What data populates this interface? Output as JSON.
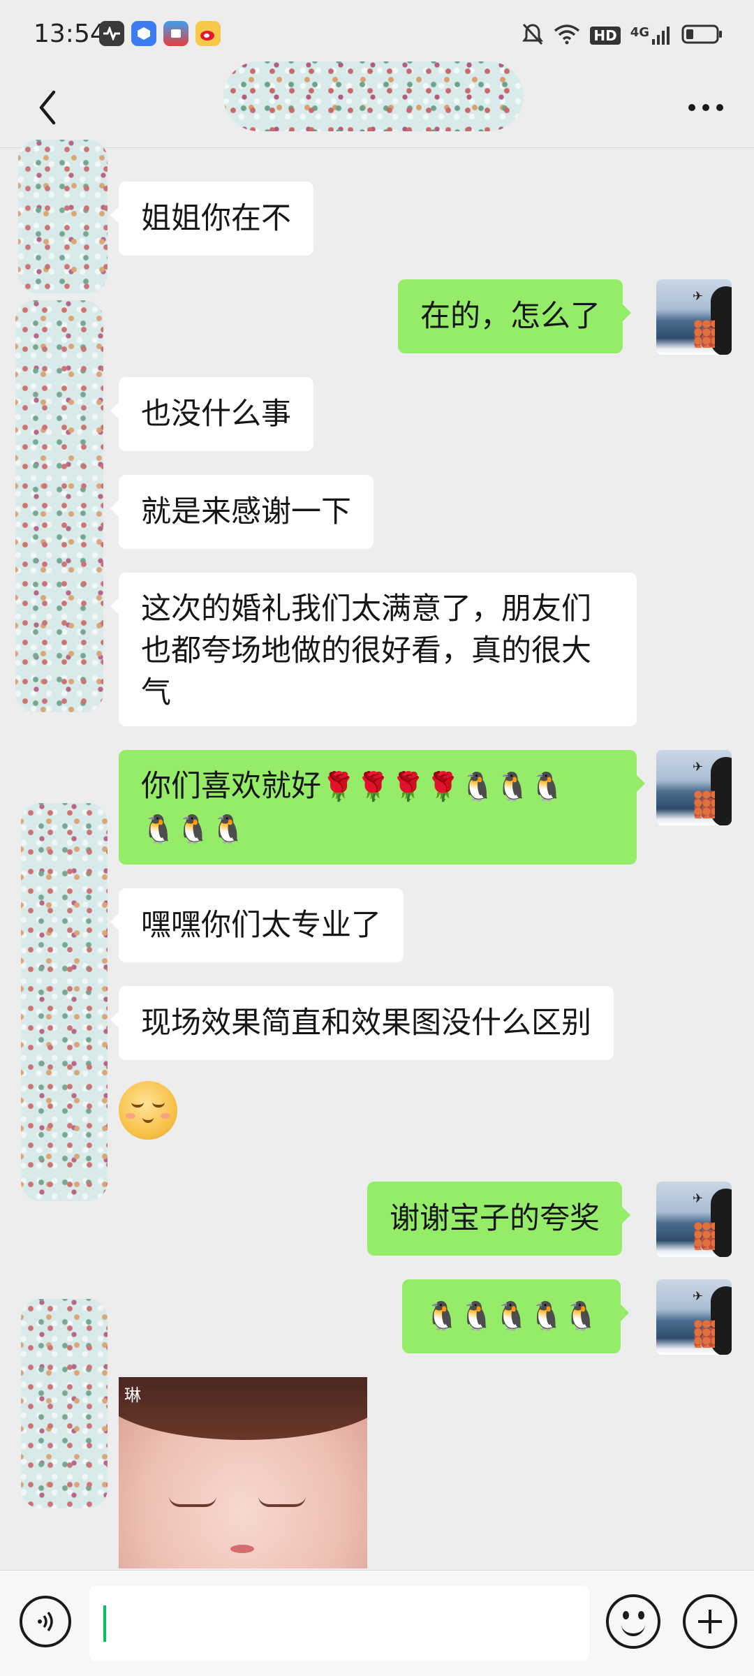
{
  "status_bar": {
    "time": "13:54",
    "app_icons": [
      "health-app-icon",
      "task-app-icon",
      "shop-app-icon",
      "weibo-icon"
    ],
    "indicators": [
      "mute-icon",
      "wifi-icon",
      "hd-badge",
      "signal-icon",
      "battery-icon"
    ],
    "hd_label": "HD",
    "network_label": "4G"
  },
  "header": {
    "back_icon": "back-chevron-icon",
    "more_icon": "more-dots-icon",
    "more_glyph": "•••"
  },
  "messages": [
    {
      "side": "left",
      "type": "text",
      "text": "姐姐你在不"
    },
    {
      "side": "right",
      "type": "text",
      "text": "在的，怎么了"
    },
    {
      "side": "left",
      "type": "text",
      "text": "也没什么事"
    },
    {
      "side": "left",
      "type": "text",
      "text": "就是来感谢一下"
    },
    {
      "side": "left",
      "type": "text",
      "lines": [
        "这次的婚礼我们太满意了，朋友们",
        "也都夸场地做的很好看，真的很大",
        "气"
      ]
    },
    {
      "side": "right",
      "type": "text",
      "text": "你们喜欢就好",
      "emoji": [
        "rose",
        "rose",
        "rose",
        "rose",
        "penguin",
        "penguin",
        "penguin",
        "penguin",
        "penguin",
        "penguin"
      ]
    },
    {
      "side": "left",
      "type": "text",
      "text": "嘿嘿你们太专业了"
    },
    {
      "side": "left",
      "type": "text",
      "text": "现场效果简直和效果图没什么区别"
    },
    {
      "side": "left",
      "type": "sticker",
      "sticker": "shy-smile-emoji"
    },
    {
      "side": "right",
      "type": "text",
      "text": "谢谢宝子的夸奖"
    },
    {
      "side": "right",
      "type": "emoji-only",
      "emoji": [
        "penguin",
        "penguin",
        "penguin",
        "penguin",
        "penguin"
      ]
    },
    {
      "side": "left",
      "type": "image",
      "watermark": "琳"
    }
  ],
  "emoji_glyphs": {
    "rose": "🌹",
    "penguin": "🐧"
  },
  "colors": {
    "background": "#ededed",
    "self_bubble": "#95ec69",
    "other_bubble": "#ffffff",
    "caret": "#07c160"
  },
  "input_bar": {
    "voice_icon": "voice-toggle-icon",
    "emoji_icon": "emoji-icon",
    "plus_icon": "more-plus-icon",
    "value": "",
    "placeholder": ""
  }
}
